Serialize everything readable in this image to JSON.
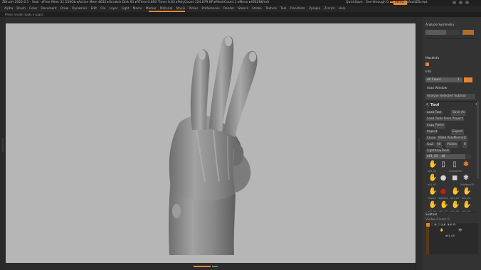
{
  "titlebar": {
    "left_text": "ZBrush 2022.0.1  · Seal  · ▸Free Mem 31.559Gb ▸Active Mem 4632 ▸Scratch Disk 81 ▸RTime 0.660 Timer 0.02 ▸PolyCount 124.879 KP ▸MeshCount 1  ▸Move ▸493288/m0",
    "guidance_label": "QuickSave",
    "see_through_label": "See-through 0",
    "menus_label": "Menus",
    "default_script_label": "DefaultZScript"
  },
  "menubar": {
    "items": [
      "Alpha",
      "Brush",
      "Color",
      "Document",
      "Draw",
      "Dynamics",
      "Edit",
      "File",
      "Layer",
      "Light",
      "Macro",
      "Marker",
      "Material",
      "Movie",
      "Picker",
      "Preferences",
      "Render",
      "Stencil",
      "Stroke",
      "Texture",
      "Tool",
      "Transform",
      "Zplugin",
      "Zscript",
      "Help"
    ]
  },
  "infobar": {
    "text": "Press render tools in pass"
  },
  "panel": {
    "analyze_symmetry": "Analyze Symmetry",
    "mask_label": "MaskInfo",
    "info_label": "Info",
    "all_count": "All Count",
    "all_value": "1",
    "auto_window": "Auto Window",
    "analyze_selected": "Analyze Selected Subtool",
    "tool_title": "Tool",
    "load_tool": "Load Tool",
    "save_as": "Save As",
    "load_tools_project": "Load Tools From Project",
    "copy": "Copy",
    "paste": "Paste",
    "import": "Import",
    "export": "Export",
    "clone": "Clone",
    "make_polymesh": "Make PolyMesh3D",
    "goz": "GoZ",
    "all": "All",
    "visible": "Visible",
    "r": "R",
    "lightbox_tools": "Lightbox▸Tools",
    "current_tool": "a01_05",
    "current_value": "48",
    "subtool_title": "Subtool",
    "visible_count": "Visible Count: 8",
    "subtool_name": "a01_05"
  },
  "thumbs": [
    {
      "label": "a01_05",
      "icon": "hand-icon"
    },
    {
      "label": "",
      "icon": "cylinder-icon"
    },
    {
      "label": "Cylinder3D",
      "icon": "cylinder-icon"
    },
    {
      "label": "",
      "icon": "star-icon"
    },
    {
      "label": "a01_05",
      "icon": "hand-icon"
    },
    {
      "label": "",
      "icon": "sphere-icon"
    },
    {
      "label": "",
      "icon": "cube-icon"
    },
    {
      "label": "PolyMesh3D",
      "icon": "star-icon"
    },
    {
      "label": "TPose1",
      "icon": "hand-icon"
    },
    {
      "label": "Zsphere",
      "icon": "sphere-icon"
    },
    {
      "label": "a01_03",
      "icon": "hand-icon"
    },
    {
      "label": "a01_04",
      "icon": "hand-icon"
    },
    {
      "label": "a01_06",
      "icon": "hand-icon"
    },
    {
      "label": "a01_07",
      "icon": "hand-icon"
    },
    {
      "label": "a01_08",
      "icon": "hand-icon"
    },
    {
      "label": "a01_09",
      "icon": "hand-icon"
    }
  ],
  "colors": {
    "accent": "#e8842b",
    "viewport_bg": "#b6b6b6",
    "panel_bg": "#333333",
    "model": "#8e8e8e"
  }
}
